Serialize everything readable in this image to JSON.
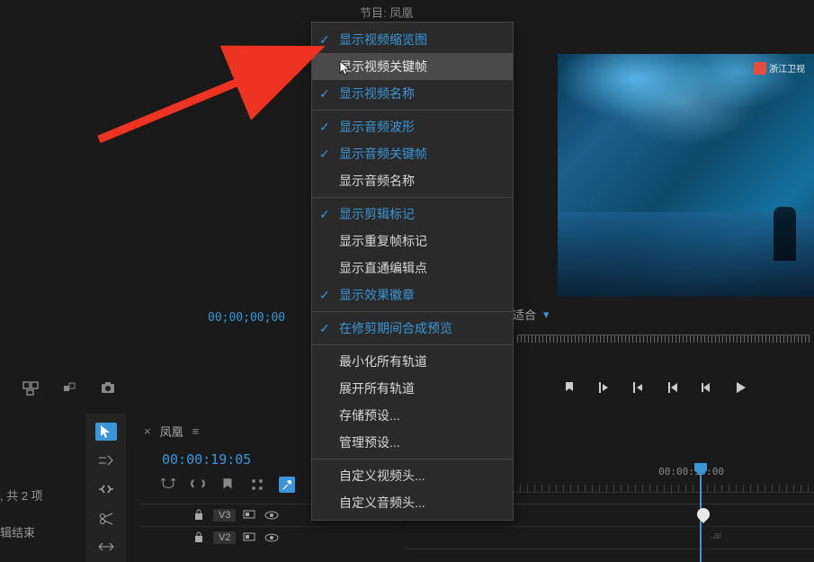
{
  "panel_title": "节目: 凤凰",
  "watermark_text": "浙江卫视",
  "timecode_source": "00;00;00;00",
  "fit_label": "适合",
  "left_panel": {
    "items_label": ", 共 2 项",
    "edit_end": "辑结束"
  },
  "sequence": {
    "name": "凤凰",
    "timecode": "00:00:19:05"
  },
  "timeline": {
    "ruler_time": "00:00:15:00",
    "tracks": {
      "v3": "V3",
      "v2": "V2"
    },
    "clip_text": ".ai"
  },
  "context_menu": {
    "items": [
      {
        "label": "显示视频缩览图",
        "checked": true
      },
      {
        "label": "显示视频关键帧",
        "checked": false,
        "highlighted": true
      },
      {
        "label": "显示视频名称",
        "checked": true
      },
      {
        "sep": true
      },
      {
        "label": "显示音频波形",
        "checked": true
      },
      {
        "label": "显示音频关键帧",
        "checked": true
      },
      {
        "label": "显示音频名称",
        "checked": false
      },
      {
        "sep": true
      },
      {
        "label": "显示剪辑标记",
        "checked": true
      },
      {
        "label": "显示重复帧标记",
        "checked": false
      },
      {
        "label": "显示直通编辑点",
        "checked": false
      },
      {
        "label": "显示效果徽章",
        "checked": true
      },
      {
        "sep": true
      },
      {
        "label": "在修剪期间合成预览",
        "checked": true
      },
      {
        "sep": true
      },
      {
        "label": "最小化所有轨道",
        "checked": false
      },
      {
        "label": "展开所有轨道",
        "checked": false
      },
      {
        "label": "存储预设...",
        "checked": false
      },
      {
        "label": "管理预设...",
        "checked": false
      },
      {
        "sep": true
      },
      {
        "label": "自定义视频头...",
        "checked": false
      },
      {
        "label": "自定义音频头...",
        "checked": false
      }
    ]
  }
}
